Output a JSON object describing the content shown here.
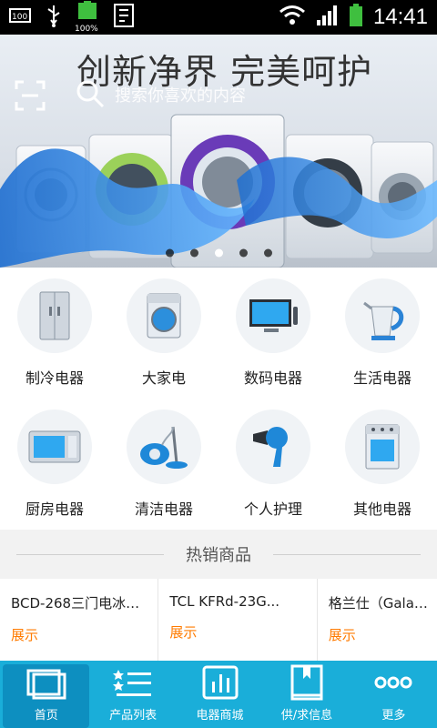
{
  "status_bar": {
    "time": "14:41",
    "battery_percent_label": "100%",
    "icons": [
      "battery-100-icon",
      "usb-icon",
      "battery-charging-icon",
      "notification-app-icon",
      "wifi-icon",
      "signal-icon",
      "battery-icon"
    ]
  },
  "banner": {
    "title": "创新净界  完美呵护",
    "search_placeholder": "搜索你喜欢的内容",
    "page_indicator": {
      "count": 5,
      "active_index": 2
    }
  },
  "categories": [
    {
      "label": "制冷电器",
      "icon": "refrigerator-icon"
    },
    {
      "label": "大家电",
      "icon": "washing-machine-icon"
    },
    {
      "label": "数码电器",
      "icon": "tv-icon"
    },
    {
      "label": "生活电器",
      "icon": "kettle-icon"
    },
    {
      "label": "厨房电器",
      "icon": "microwave-icon"
    },
    {
      "label": "清洁电器",
      "icon": "vacuum-icon"
    },
    {
      "label": "个人护理",
      "icon": "hairdryer-icon"
    },
    {
      "label": "其他电器",
      "icon": "oven-icon"
    }
  ],
  "hot_section": {
    "title": "热销商品"
  },
  "products": [
    {
      "name": "BCD-268三门电冰箱 ...",
      "tag": "展示"
    },
    {
      "name": "TCL KFRd-23G...",
      "tag": "展示"
    },
    {
      "name": "格兰仕（Galan...",
      "tag": "展示"
    }
  ],
  "tabs": [
    {
      "label": "首页",
      "icon": "home-icon",
      "active": true
    },
    {
      "label": "产品列表",
      "icon": "list-icon",
      "active": false
    },
    {
      "label": "电器商城",
      "icon": "shop-icon",
      "active": false
    },
    {
      "label": "供/求信息",
      "icon": "book-icon",
      "active": false
    },
    {
      "label": "更多",
      "icon": "more-icon",
      "active": false
    }
  ],
  "colors": {
    "accent": "#1aaed9",
    "accent_active": "#0d8fc0",
    "tag": "#ff7b00"
  }
}
